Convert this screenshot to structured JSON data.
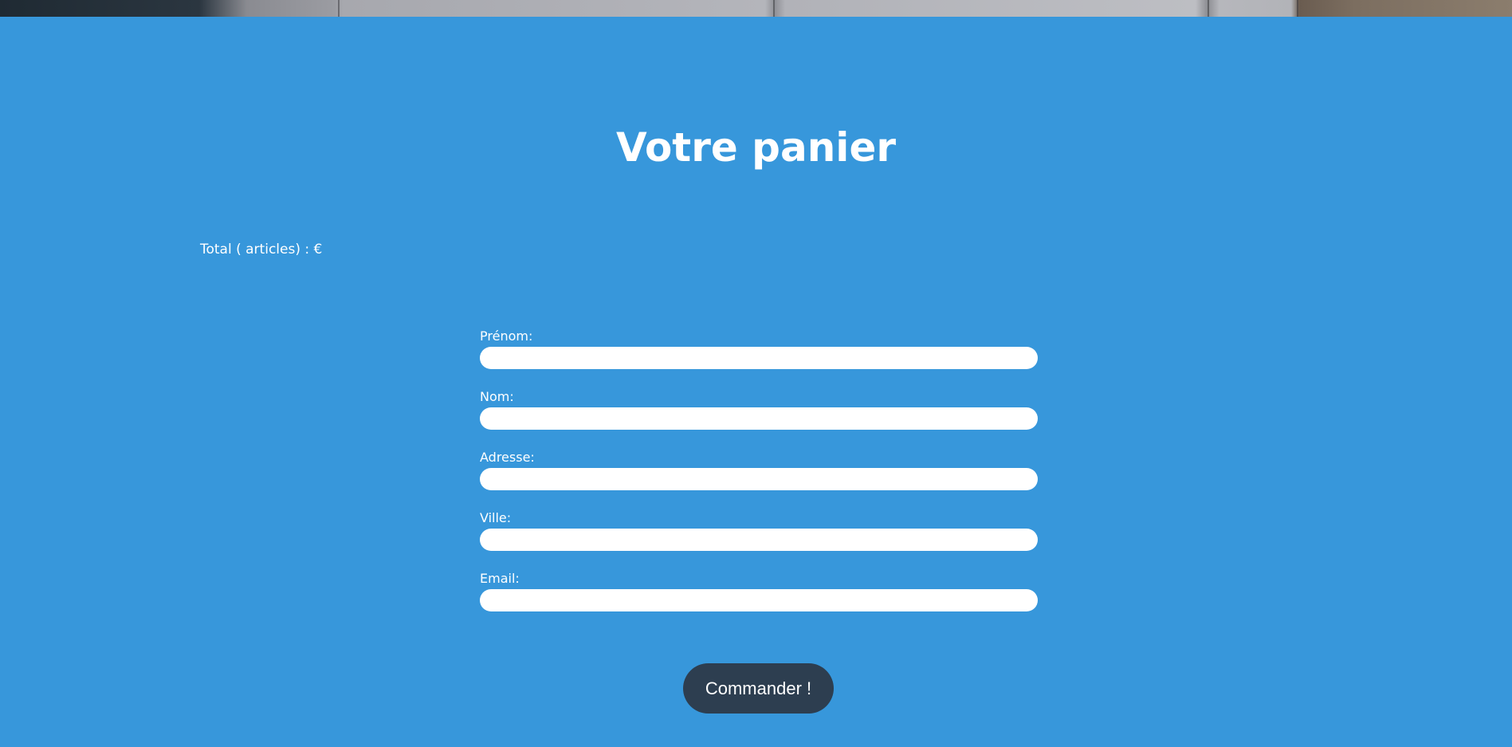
{
  "page": {
    "title": "Votre panier",
    "background_color": "#3797db",
    "hero_image": "sofa-photo-strip"
  },
  "cart": {
    "total_label": "Total ( articles) : €"
  },
  "form": {
    "fields": [
      {
        "label": "Prénom:",
        "value": "",
        "placeholder": ""
      },
      {
        "label": "Nom:",
        "value": "",
        "placeholder": ""
      },
      {
        "label": "Adresse:",
        "value": "",
        "placeholder": ""
      },
      {
        "label": "Ville:",
        "value": "",
        "placeholder": ""
      },
      {
        "label": "Email:",
        "value": "",
        "placeholder": ""
      }
    ],
    "submit_label": "Commander !",
    "submit_color": "#2d3e50"
  }
}
